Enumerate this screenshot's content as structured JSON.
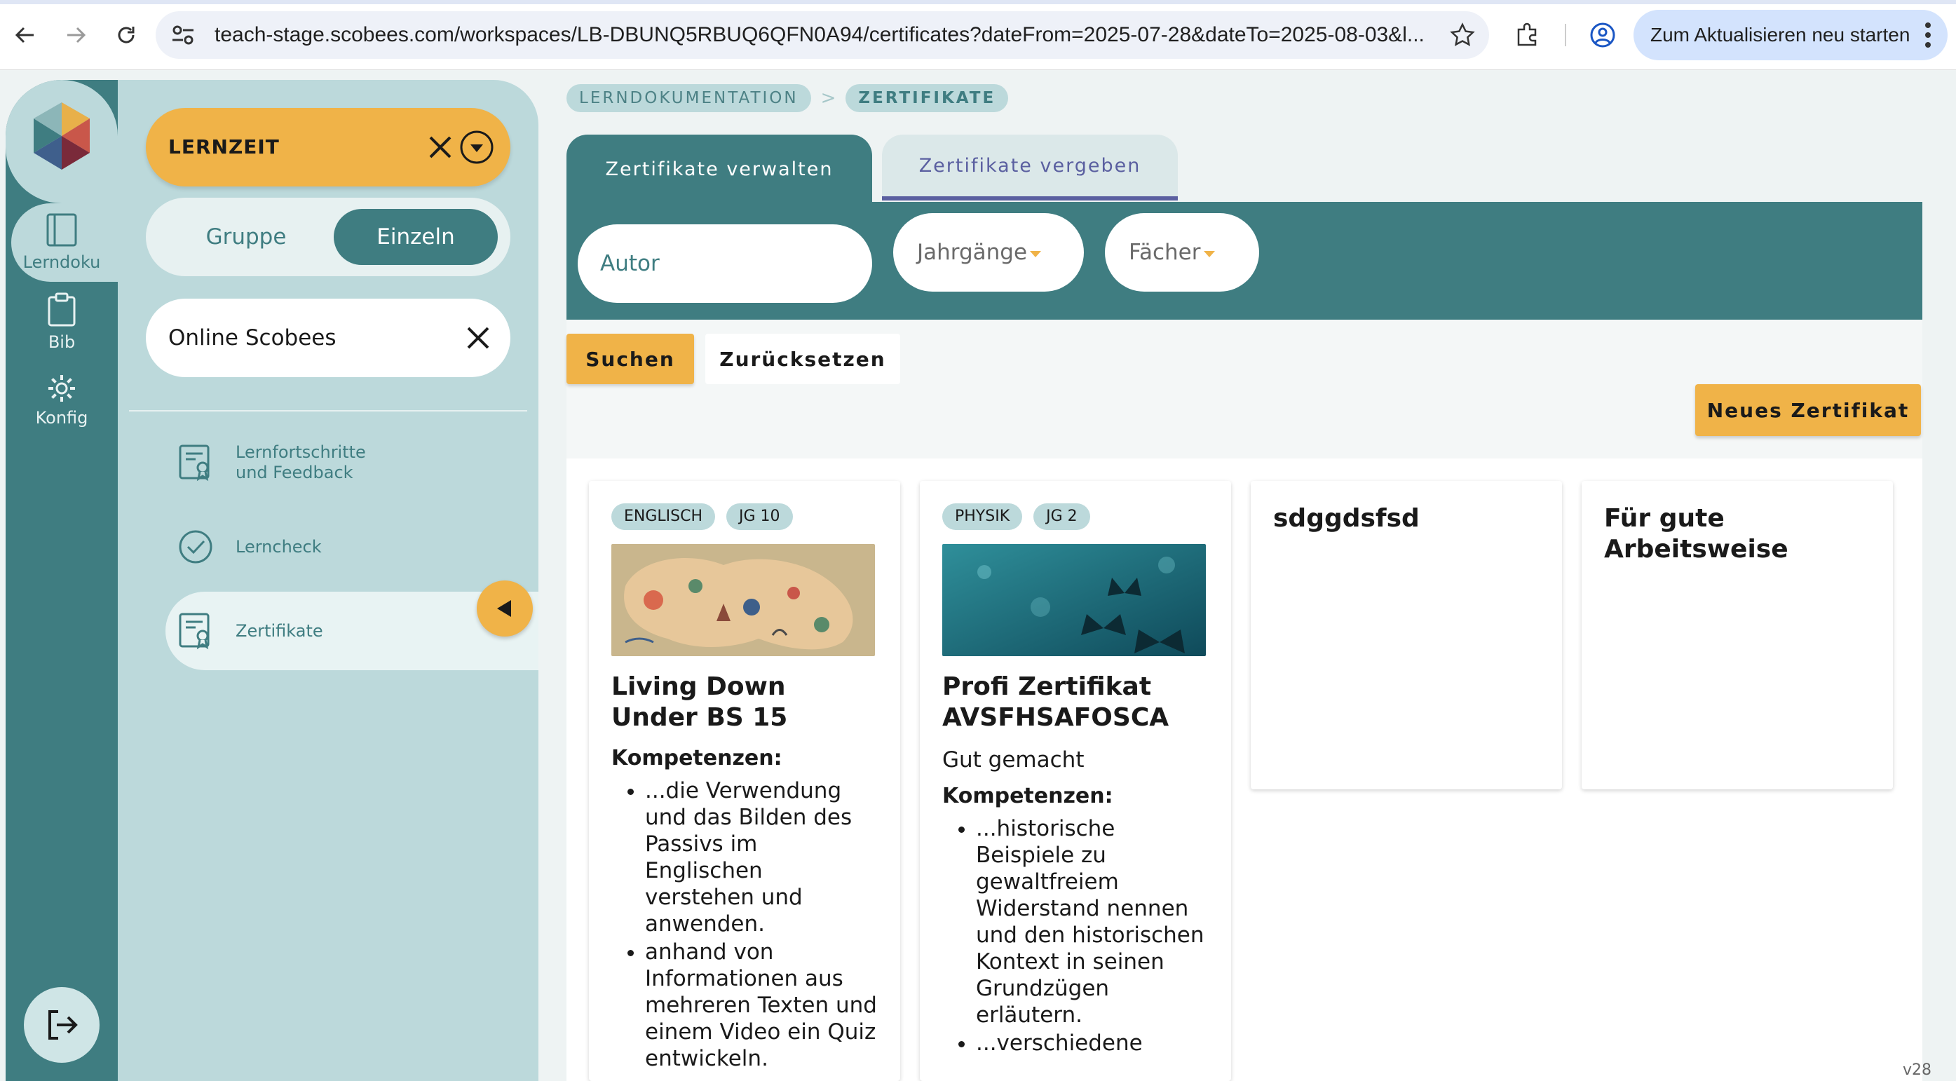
{
  "browser": {
    "url": "teach-stage.scobees.com/workspaces/LB-DBUNQ5RBUQ6QFN0A94/certificates?dateFrom=2025-07-28&dateTo=2025-08-03&l...",
    "restart_label": "Zum Aktualisieren neu starten"
  },
  "rail": {
    "items": [
      {
        "label": "Lerndoku",
        "icon": "book-icon"
      },
      {
        "label": "Bib",
        "icon": "clipboard-icon"
      },
      {
        "label": "Konfig",
        "icon": "gear-icon"
      }
    ]
  },
  "panel": {
    "lernzeit_label": "LERNZEIT",
    "toggle": {
      "gruppe": "Gruppe",
      "einzeln": "Einzeln"
    },
    "school": "Online Scobees",
    "menu": [
      {
        "label": "Lernfortschritte\nund Feedback",
        "icon": "certificate-icon"
      },
      {
        "label": "Lerncheck",
        "icon": "check-circle-icon"
      },
      {
        "label": "Zertifikate",
        "icon": "certificate-icon"
      }
    ]
  },
  "breadcrumb": {
    "parent": "LERNDOKUMENTATION",
    "separator": ">",
    "current": "ZERTIFIKATE"
  },
  "tabs": {
    "manage": "Zertifikate verwalten",
    "assign": "Zertifikate vergeben"
  },
  "filters": {
    "author_placeholder": "Autor",
    "grades": "Jahrgänge",
    "subjects": "Fächer"
  },
  "buttons": {
    "search": "Suchen",
    "reset": "Zurücksetzen",
    "new": "Neues Zertifikat"
  },
  "cards": [
    {
      "tags": [
        "ENGLISCH",
        "JG 10"
      ],
      "title": "Living Down Under BS 15",
      "subtitle": "",
      "competencies_label": "Kompetenzen:",
      "competencies": [
        "...die Verwendung und das Bilden des Passivs im Englischen verstehen und anwenden.",
        "anhand von Informationen aus mehreren Texten und einem Video ein Quiz entwickeln."
      ]
    },
    {
      "tags": [
        "PHYSIK",
        "JG 2"
      ],
      "title": "Profi Zertifikat AVSFHSAFOSCA",
      "subtitle": "Gut gemacht",
      "competencies_label": "Kompetenzen:",
      "competencies": [
        "...historische Beispiele zu gewaltfreiem Widerstand nennen und den historischen Kontext in seinen Grundzügen erläutern.",
        "...verschiedene"
      ]
    },
    {
      "title": "sdggdsfsd"
    },
    {
      "title": "Für gute Arbeitsweise"
    }
  ],
  "version": "v28",
  "colors": {
    "teal": "#3f7d81",
    "light_teal": "#bcd9db",
    "accent": "#f0b348",
    "tab_inactive_text": "#5a5fa0"
  }
}
